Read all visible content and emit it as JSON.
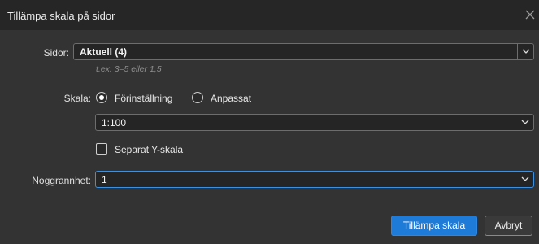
{
  "window": {
    "title": "Tillämpa skala på sidor"
  },
  "pages": {
    "label": "Sidor:",
    "value": "Aktuell (4)",
    "hint": "t.ex. 3–5 eller 1,5"
  },
  "scale": {
    "label": "Skala:",
    "options": [
      {
        "label": "Förinställning",
        "selected": true
      },
      {
        "label": "Anpassat",
        "selected": false
      }
    ],
    "preset_value": "1:100",
    "separate_y": {
      "label": "Separat Y-skala",
      "checked": false
    }
  },
  "precision": {
    "label": "Noggrannhet:",
    "value": "1"
  },
  "buttons": {
    "apply": "Tillämpa skala",
    "cancel": "Avbryt"
  },
  "colors": {
    "background": "#333333",
    "titlebar": "#262626",
    "accent": "#1f7bd8",
    "focus_border": "#3d8fe0"
  }
}
